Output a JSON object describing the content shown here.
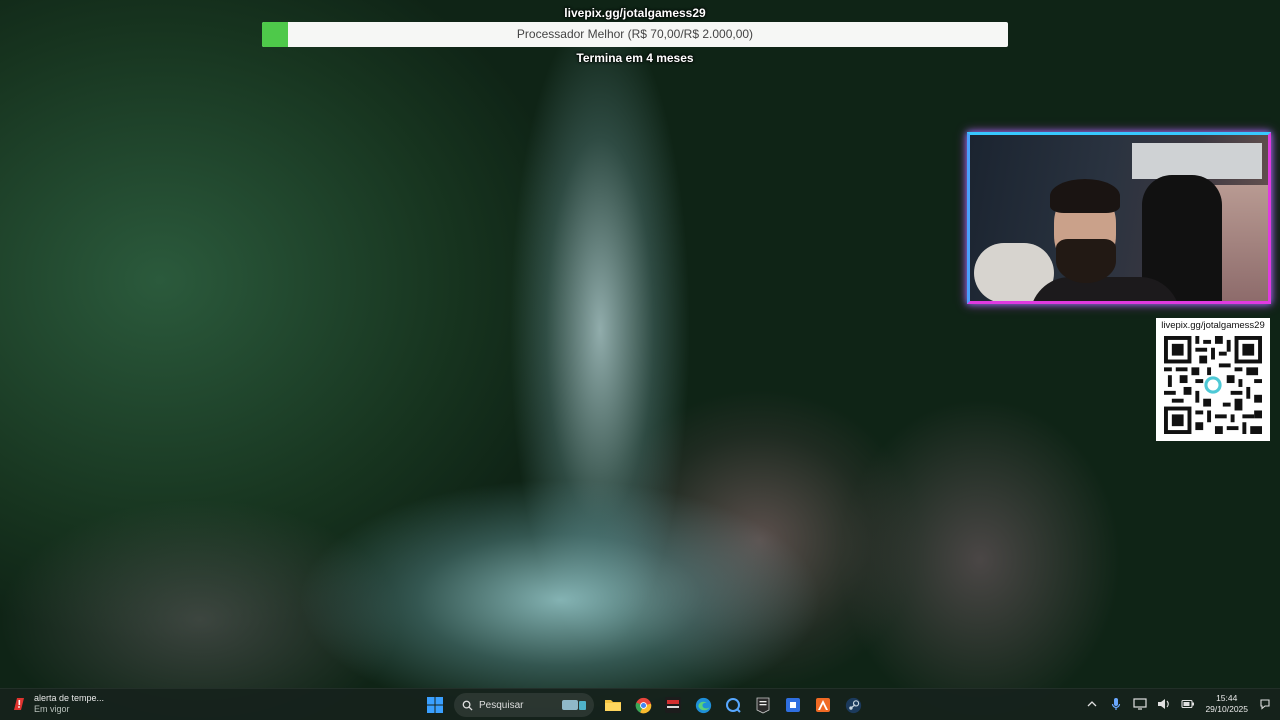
{
  "goal": {
    "url": "livepix.gg/jotalgamess29",
    "label": "Processador Melhor (R$ 70,00/R$ 2.000,00)",
    "raised": 70,
    "target": 2000,
    "deadline": "Termina em 4 meses",
    "fill_color": "#4ec94a"
  },
  "qr": {
    "url": "livepix.gg/jotalgamess29"
  },
  "taskbar": {
    "weather": {
      "title": "alerta de tempe...",
      "subtitle": "Em vigor"
    },
    "search_placeholder": "Pesquisar",
    "apps": [
      "windows-start-icon",
      "search-icon",
      "file-explorer-icon",
      "chrome-icon",
      "app-red-icon",
      "edge-icon",
      "app-blue-icon",
      "epic-games-icon",
      "app-square-icon",
      "app-orange-icon",
      "steam-icon"
    ],
    "clock": {
      "time": "15:44",
      "date": "29/10/2025"
    }
  },
  "colors": {
    "webcam_border_pink": "#e03ae0",
    "webcam_border_blue": "#38c8ff",
    "taskbar_bg": "#16221c"
  }
}
